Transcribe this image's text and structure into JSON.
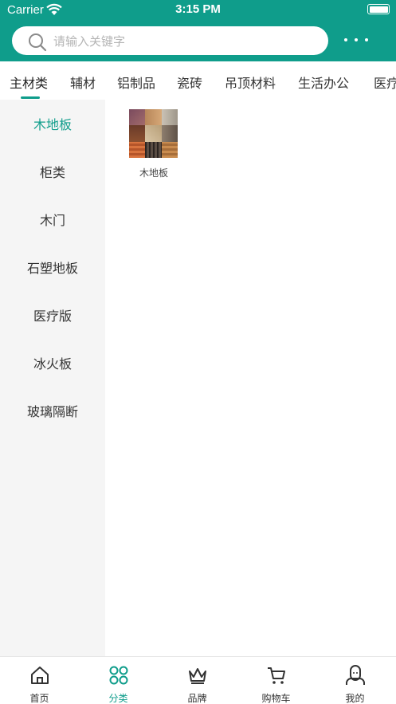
{
  "status_bar": {
    "carrier": "Carrier",
    "time": "3:15 PM"
  },
  "search": {
    "placeholder": "请输入关键字"
  },
  "tabs": [
    {
      "label": "主材类",
      "active": true
    },
    {
      "label": "辅材"
    },
    {
      "label": "铝制品"
    },
    {
      "label": "瓷砖"
    },
    {
      "label": "吊顶材料"
    },
    {
      "label": "生活办公"
    },
    {
      "label": "医疗"
    }
  ],
  "sidebar": {
    "items": [
      {
        "label": "木地板",
        "active": true
      },
      {
        "label": "柜类"
      },
      {
        "label": "木门"
      },
      {
        "label": "石塑地板"
      },
      {
        "label": "医疗版"
      },
      {
        "label": "冰火板"
      },
      {
        "label": "玻璃隔断"
      }
    ]
  },
  "products": [
    {
      "label": "木地板",
      "image": "wood-floor-samples-thumbnail"
    }
  ],
  "bottom_nav": [
    {
      "label": "首页",
      "icon": "home-icon"
    },
    {
      "label": "分类",
      "icon": "category-grid-icon",
      "active": true
    },
    {
      "label": "品牌",
      "icon": "crown-icon"
    },
    {
      "label": "购物车",
      "icon": "cart-icon"
    },
    {
      "label": "我的",
      "icon": "user-icon"
    }
  ],
  "colors": {
    "accent": "#0f9d8b",
    "sidebar_bg": "#f5f5f5"
  }
}
